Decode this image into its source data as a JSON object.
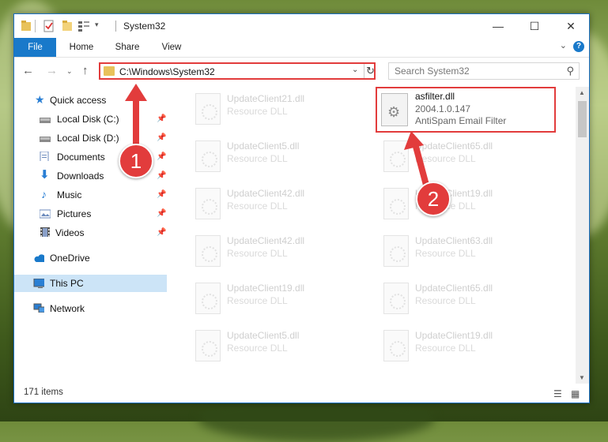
{
  "window": {
    "title": "System32",
    "controls": {
      "minimize": "—",
      "maximize": "☐",
      "close": "✕"
    }
  },
  "ribbon": {
    "tabs": [
      "File",
      "Home",
      "Share",
      "View"
    ],
    "help": "?"
  },
  "navigation": {
    "address_path": "C:\\Windows\\System32",
    "search_placeholder": "Search System32"
  },
  "sidebar": {
    "quick_access": "Quick access",
    "items": [
      {
        "label": "Local Disk (C:)",
        "icon": "drive-icon",
        "pinned": true
      },
      {
        "label": "Local Disk (D:)",
        "icon": "drive-icon",
        "pinned": true
      },
      {
        "label": "Documents",
        "icon": "documents-icon",
        "pinned": true
      },
      {
        "label": "Downloads",
        "icon": "download-icon",
        "pinned": true
      },
      {
        "label": "Music",
        "icon": "music-icon",
        "pinned": true
      },
      {
        "label": "Pictures",
        "icon": "pictures-icon",
        "pinned": true
      },
      {
        "label": "Videos",
        "icon": "videos-icon",
        "pinned": true
      }
    ],
    "onedrive": "OneDrive",
    "this_pc": "This PC",
    "network": "Network"
  },
  "files": {
    "left_column": [
      {
        "name": "UpdateClient21.dll",
        "type": "Resource DLL"
      },
      {
        "name": "UpdateClient5.dll",
        "type": "Resource DLL"
      },
      {
        "name": "UpdateClient42.dll",
        "type": "Resource DLL"
      },
      {
        "name": "UpdateClient42.dll",
        "type": "Resource DLL"
      },
      {
        "name": "UpdateClient19.dll",
        "type": "Resource DLL"
      },
      {
        "name": "UpdateClient5.dll",
        "type": "Resource DLL"
      }
    ],
    "right_column": [
      {
        "name": "UpdateClient65.dll",
        "type": "Resource DLL"
      },
      {
        "name": "UpdateClient19.dll",
        "type": "Resource DLL"
      },
      {
        "name": "UpdateClient63.dll",
        "type": "Resource DLL"
      },
      {
        "name": "UpdateClient65.dll",
        "type": "Resource DLL"
      },
      {
        "name": "UpdateClient19.dll",
        "type": "Resource DLL"
      }
    ],
    "highlighted": {
      "name": "asfilter.dll",
      "version": "2004.1.0.147",
      "description": "AntiSpam Email Filter"
    }
  },
  "status": {
    "item_count": "171 items"
  },
  "annotations": {
    "step1": "1",
    "step2": "2",
    "color": "#e23c3c"
  }
}
